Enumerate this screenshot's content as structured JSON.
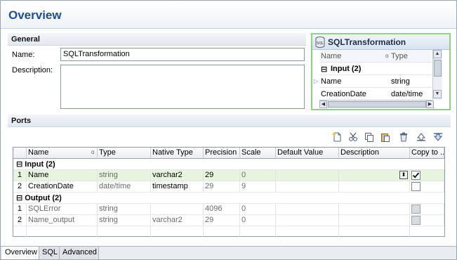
{
  "header": {
    "title": "Overview"
  },
  "general": {
    "section_title": "General",
    "name_label": "Name:",
    "name_value": "SQLTransformation",
    "description_label": "Description:",
    "description_value": ""
  },
  "preview": {
    "title": "SQLTransformation",
    "col_name": "Name",
    "col_type": "Type",
    "group_label": "Input (2)",
    "rows": [
      {
        "name": "Name",
        "type": "string"
      },
      {
        "name": "CreationDate",
        "type": "date/time"
      }
    ]
  },
  "ports": {
    "section_title": "Ports",
    "columns": {
      "name": "Name",
      "type": "Type",
      "native_type": "Native Type",
      "precision": "Precision",
      "scale": "Scale",
      "default_value": "Default Value",
      "description": "Description",
      "copy_to": "Copy to ..."
    },
    "input_group": "Input (2)",
    "output_group": "Output (2)",
    "input_rows": [
      {
        "num": "1",
        "name": "Name",
        "type": "string",
        "native_type": "varchar2",
        "precision": "29",
        "scale": "0",
        "copy": true
      },
      {
        "num": "2",
        "name": "CreationDate",
        "type": "date/time",
        "native_type": "timestamp",
        "precision": "29",
        "scale": "9",
        "copy": false
      }
    ],
    "output_rows": [
      {
        "num": "1",
        "name": "SQLError",
        "type": "string",
        "native_type": "",
        "precision": "4096",
        "scale": "0"
      },
      {
        "num": "2",
        "name": "Name_output",
        "type": "string",
        "native_type": "varchar2",
        "precision": "29",
        "scale": "0"
      }
    ]
  },
  "tabs": [
    "Overview",
    "SQL",
    "Advanced"
  ],
  "colors": {
    "accent": "#1f4e8f",
    "selected_row": "#e8f5de",
    "preview_border": "#8fd17d"
  }
}
